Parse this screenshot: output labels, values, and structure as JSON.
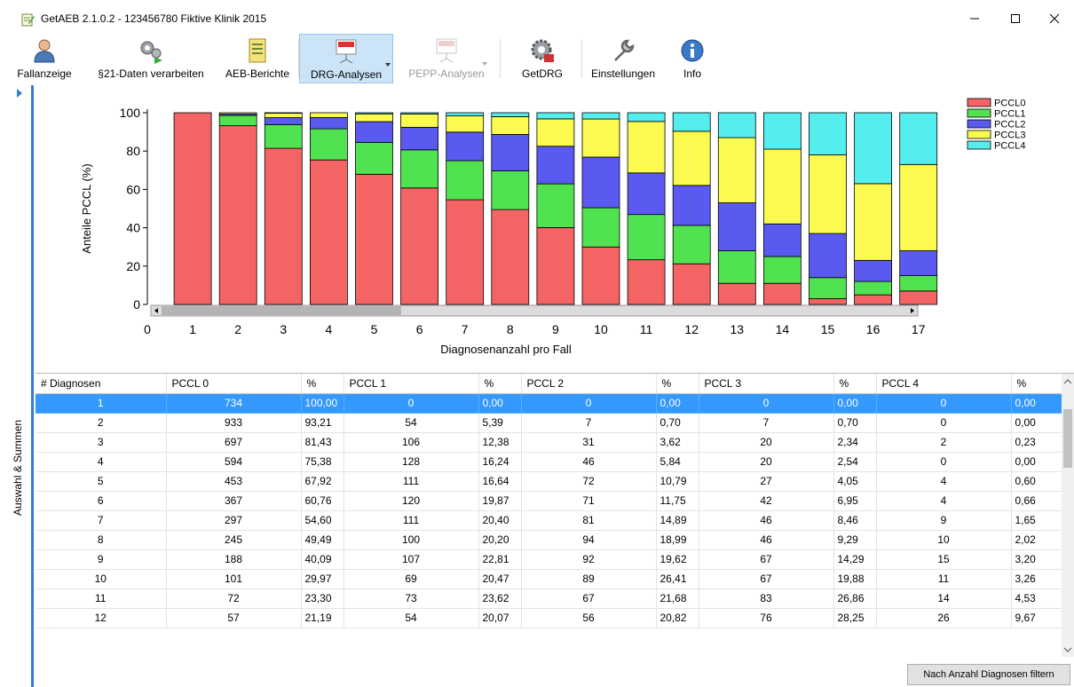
{
  "window": {
    "title": "GetAEB 2.1.0.2 - 123456780 Fiktive Klinik 2015"
  },
  "toolbar": {
    "items": [
      {
        "label": "Fallanzeige",
        "icon": "user-icon"
      },
      {
        "label": "§21-Daten verarbeiten",
        "icon": "gears-play-icon"
      },
      {
        "label": "AEB-Berichte",
        "icon": "report-icon"
      },
      {
        "label": "DRG-Analysen",
        "icon": "drg-chart-icon"
      },
      {
        "label": "PEPP-Analysen",
        "icon": "pepp-chart-icon"
      },
      {
        "label": "GetDRG",
        "icon": "gear-drg-icon"
      },
      {
        "label": "Einstellungen",
        "icon": "wrench-icon"
      },
      {
        "label": "Info",
        "icon": "info-icon"
      }
    ]
  },
  "leftstrip": {
    "label": "Auswahl & Summen"
  },
  "chart_data": {
    "type": "bar",
    "stacked": true,
    "ylabel": "Anteile PCCL (%)",
    "xlabel": "Diagnosenanzahl pro Fall",
    "ylim": [
      0,
      100
    ],
    "yticks": [
      0,
      20,
      40,
      60,
      80,
      100
    ],
    "xticks": [
      "0",
      "1",
      "2",
      "3",
      "4",
      "5",
      "6",
      "7",
      "8",
      "9",
      "10",
      "11",
      "12",
      "13",
      "14",
      "15",
      "16",
      "17"
    ],
    "categories": [
      "1",
      "2",
      "3",
      "4",
      "5",
      "6",
      "7",
      "8",
      "9",
      "10",
      "11",
      "12",
      "13",
      "14",
      "15",
      "16",
      "17"
    ],
    "legend_position": "top-right",
    "series": [
      {
        "name": "PCCL0",
        "color": "#f46464",
        "values": [
          100.0,
          93.21,
          81.43,
          75.38,
          67.92,
          60.76,
          54.6,
          49.49,
          40.09,
          29.97,
          23.3,
          21.19,
          11,
          11,
          3,
          5,
          7
        ]
      },
      {
        "name": "PCCL1",
        "color": "#50e250",
        "values": [
          0.0,
          5.39,
          12.38,
          16.24,
          16.64,
          19.87,
          20.4,
          20.2,
          22.81,
          20.47,
          23.62,
          20.07,
          17,
          14,
          11,
          7,
          8
        ]
      },
      {
        "name": "PCCL2",
        "color": "#5a5af0",
        "values": [
          0.0,
          0.7,
          3.62,
          5.84,
          10.79,
          11.75,
          14.89,
          18.99,
          19.62,
          26.41,
          21.68,
          20.82,
          25,
          17,
          23,
          11,
          13
        ]
      },
      {
        "name": "PCCL3",
        "color": "#fafa50",
        "values": [
          0.0,
          0.7,
          2.34,
          2.54,
          4.05,
          6.95,
          8.46,
          9.29,
          14.29,
          19.88,
          26.86,
          28.25,
          34,
          39,
          41,
          40,
          45
        ]
      },
      {
        "name": "PCCL4",
        "color": "#55eeee",
        "values": [
          0.0,
          0.0,
          0.23,
          0.0,
          0.6,
          0.66,
          1.65,
          2.02,
          3.2,
          3.26,
          4.53,
          9.67,
          13,
          19,
          22,
          37,
          27
        ]
      }
    ]
  },
  "table": {
    "columns": [
      "# Diagnosen",
      "PCCL 0",
      "%",
      "PCCL 1",
      "%",
      "PCCL 2",
      "%",
      "PCCL 3",
      "%",
      "PCCL 4",
      "%"
    ],
    "rows": [
      [
        "1",
        "734",
        "100,00",
        "0",
        "0,00",
        "0",
        "0,00",
        "0",
        "0,00",
        "0",
        "0,00"
      ],
      [
        "2",
        "933",
        "93,21",
        "54",
        "5,39",
        "7",
        "0,70",
        "7",
        "0,70",
        "0",
        "0,00"
      ],
      [
        "3",
        "697",
        "81,43",
        "106",
        "12,38",
        "31",
        "3,62",
        "20",
        "2,34",
        "2",
        "0,23"
      ],
      [
        "4",
        "594",
        "75,38",
        "128",
        "16,24",
        "46",
        "5,84",
        "20",
        "2,54",
        "0",
        "0,00"
      ],
      [
        "5",
        "453",
        "67,92",
        "111",
        "16,64",
        "72",
        "10,79",
        "27",
        "4,05",
        "4",
        "0,60"
      ],
      [
        "6",
        "367",
        "60,76",
        "120",
        "19,87",
        "71",
        "11,75",
        "42",
        "6,95",
        "4",
        "0,66"
      ],
      [
        "7",
        "297",
        "54,60",
        "111",
        "20,40",
        "81",
        "14,89",
        "46",
        "8,46",
        "9",
        "1,65"
      ],
      [
        "8",
        "245",
        "49,49",
        "100",
        "20,20",
        "94",
        "18,99",
        "46",
        "9,29",
        "10",
        "2,02"
      ],
      [
        "9",
        "188",
        "40,09",
        "107",
        "22,81",
        "92",
        "19,62",
        "67",
        "14,29",
        "15",
        "3,20"
      ],
      [
        "10",
        "101",
        "29,97",
        "69",
        "20,47",
        "89",
        "26,41",
        "67",
        "19,88",
        "11",
        "3,26"
      ],
      [
        "11",
        "72",
        "23,30",
        "73",
        "23,62",
        "67",
        "21,68",
        "83",
        "26,86",
        "14",
        "4,53"
      ],
      [
        "12",
        "57",
        "21,19",
        "54",
        "20,07",
        "56",
        "20,82",
        "76",
        "28,25",
        "26",
        "9,67"
      ]
    ],
    "selected_row": 0
  },
  "footer": {
    "filter_button": "Nach Anzahl Diagnosen filtern"
  },
  "colors": {
    "accent": "#2f7fd8",
    "selection": "#3399ff",
    "active_tool": "#cce4f7"
  }
}
